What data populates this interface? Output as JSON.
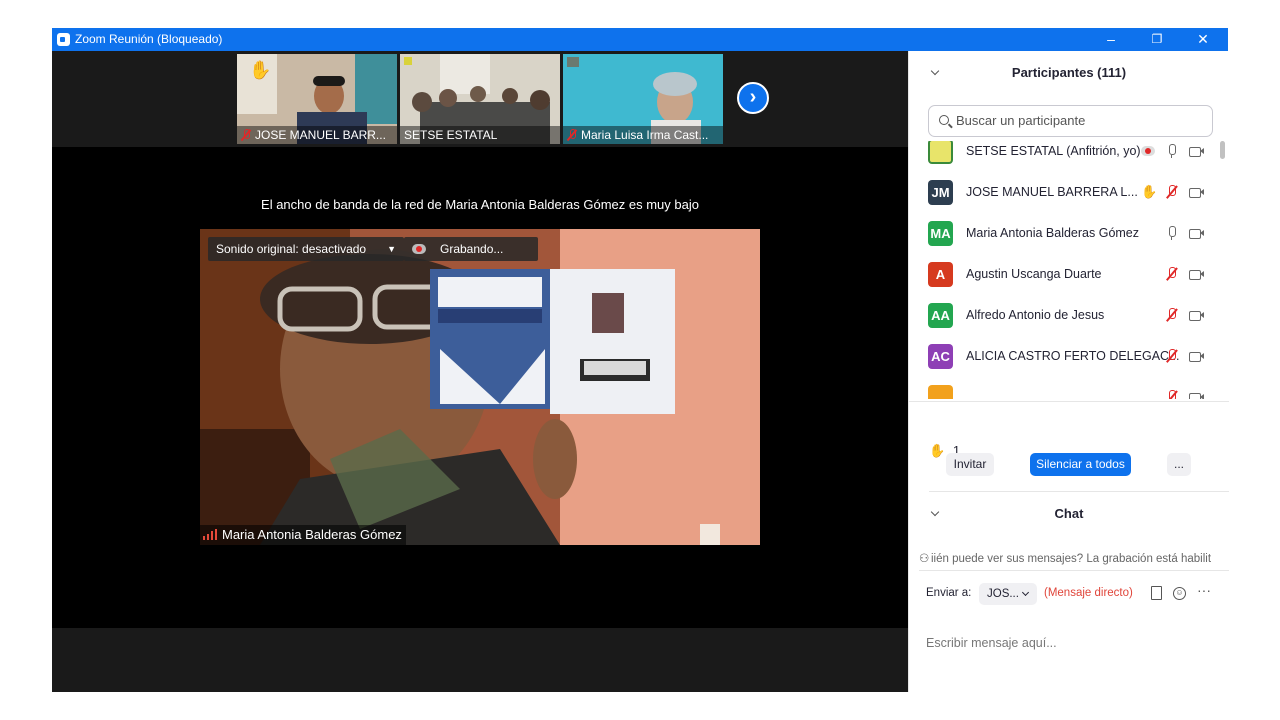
{
  "window": {
    "title": "Zoom Reunión (Bloqueado)",
    "minimize": "–",
    "restore": "❐",
    "close": "✕"
  },
  "thumbnails": [
    {
      "name": "JOSE MANUEL BARR..."
    },
    {
      "name": "SETSE ESTATAL"
    },
    {
      "name": "Maria Luisa Irma Cast..."
    }
  ],
  "next_arrow": "›",
  "bandwidth_warning": "El ancho de banda de la red de Maria Antonia Balderas Gómez es muy bajo",
  "main_video": {
    "original_sound": "Sonido original: desactivado",
    "recording": "Grabando...",
    "speaker": "Maria Antonia Balderas Gómez"
  },
  "participants": {
    "title": "Participantes (111)",
    "search_placeholder": "Buscar un participante",
    "list": [
      {
        "initials": "",
        "name": "SETSE ESTATAL (Anfitrión, yo)",
        "color": "#d9d23a",
        "mic": "on",
        "hand": false,
        "rec": true
      },
      {
        "initials": "JM",
        "name": "JOSE MANUEL BARRERA L...",
        "color": "#2d3e50",
        "mic": "off",
        "hand": true,
        "rec": false
      },
      {
        "initials": "MA",
        "name": "Maria Antonia Balderas Gómez",
        "color": "#23a650",
        "mic": "on",
        "hand": false,
        "rec": false
      },
      {
        "initials": "A",
        "name": "Agustin Uscanga Duarte",
        "color": "#d63a1f",
        "mic": "off",
        "hand": false,
        "rec": false
      },
      {
        "initials": "AA",
        "name": "Alfredo Antonio de Jesus",
        "color": "#23a650",
        "mic": "off",
        "hand": false,
        "rec": false
      },
      {
        "initials": "AC",
        "name": "ALICIA CASTRO FERTO DELEGAC...",
        "color": "#8e3fb5",
        "mic": "off",
        "hand": false,
        "rec": false
      },
      {
        "initials": "",
        "name": "",
        "color": "#f2a11c",
        "mic": "off",
        "hand": false,
        "rec": false
      }
    ],
    "raised_hands": "1",
    "invite": "Invitar",
    "mute_all": "Silenciar a todos",
    "more": "..."
  },
  "chat": {
    "title": "Chat",
    "notice": "iién puede ver sus mensajes? La grabación está habilit",
    "send_to_label": "Enviar a:",
    "recipient": "JOS...",
    "direct": "(Mensaje directo)",
    "input_placeholder": "Escribir mensaje aquí...",
    "more": "···"
  }
}
